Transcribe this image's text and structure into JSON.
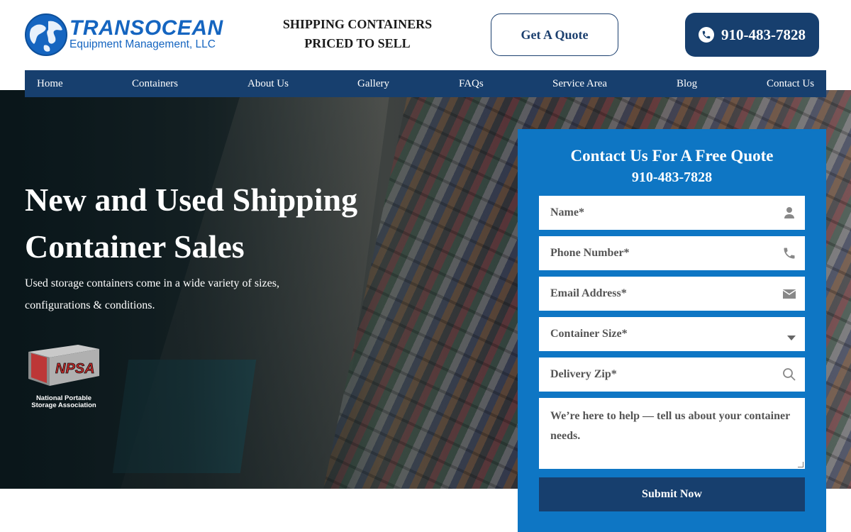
{
  "header": {
    "logo_brand": "TRANSOCEAN",
    "logo_sub": "Equipment Management, LLC",
    "tagline_line1": "SHIPPING CONTAINERS",
    "tagline_line2": "PRICED TO SELL",
    "quote_button": "Get A Quote",
    "phone_button": "910-483-7828"
  },
  "nav": {
    "items": [
      "Home",
      "Containers",
      "About Us",
      "Gallery",
      "FAQs",
      "Service Area",
      "Blog",
      "Contact Us"
    ]
  },
  "hero": {
    "title_line1": "New and Used Shipping",
    "title_line2": "Container Sales",
    "desc_line1": "Used storage containers come in a wide variety of sizes,",
    "desc_line2": "configurations & conditions.",
    "badge_logo": "NPSA",
    "badge_caption_line1": "National Portable",
    "badge_caption_line2": "Storage Association"
  },
  "form": {
    "title": "Contact Us For A Free Quote",
    "phone": "910-483-7828",
    "name_placeholder": "Name*",
    "phone_placeholder": "Phone Number*",
    "email_placeholder": "Email Address*",
    "size_select": "Container Size*",
    "zip_placeholder": "Delivery Zip*",
    "message_placeholder": "We’re here to help — tell us about your container needs.",
    "submit": "Submit Now"
  },
  "colors": {
    "navy": "#173f6e",
    "form_blue": "#0e76c4",
    "logo_blue": "#1565c0"
  },
  "icons": [
    "globe-logo-icon",
    "phone-icon",
    "user-icon",
    "phone-handset-icon",
    "envelope-icon",
    "chevron-down-icon",
    "search-icon"
  ]
}
